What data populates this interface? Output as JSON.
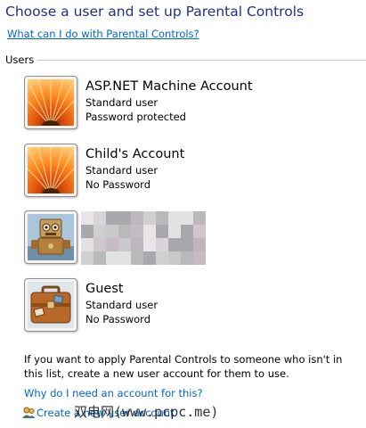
{
  "header": {
    "title": "Choose a user and set up Parental Controls",
    "help_link": "What can I do with Parental Controls?"
  },
  "users_group": {
    "label": "Users",
    "accounts": [
      {
        "name": "ASP.NET Machine Account",
        "type": "Standard user",
        "password": "Password protected",
        "avatar": "orange-flower-icon"
      },
      {
        "name": "Child's Account",
        "type": "Standard user",
        "password": "No Password",
        "avatar": "orange-flower-icon"
      },
      {
        "name": "",
        "type": "",
        "password": "",
        "avatar": "robot-icon"
      },
      {
        "name": "Guest",
        "type": "Standard user",
        "password": "No Password",
        "avatar": "briefcase-icon"
      }
    ]
  },
  "footer": {
    "info_text": "If you want to apply Parental Controls to someone who isn't in this list, create a new user account for them to use.",
    "why_link": "Why do I need an account for this?",
    "create_link": "Create a new user account",
    "watermark": "双电网(www.pcpc.me)"
  },
  "colors": {
    "title": "#1e3287",
    "link": "#0066cc"
  }
}
